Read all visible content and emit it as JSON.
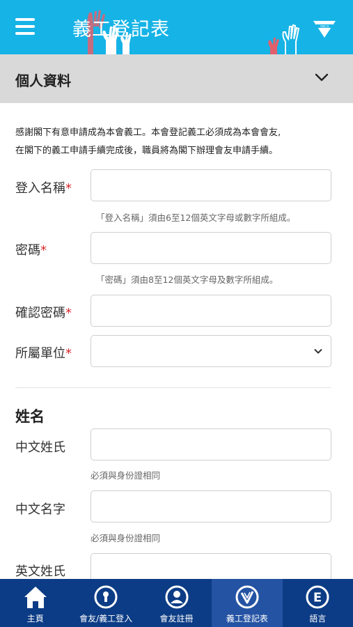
{
  "header": {
    "title": "義工登記表",
    "menu_icon": "hamburger-menu-icon",
    "logo_icon": "ymca-logo-icon",
    "bg_color": "#16b3e6"
  },
  "accordion": {
    "title": "個人資料",
    "icon": "chevron-down-icon"
  },
  "intro": {
    "line1": "感謝閣下有意申請成為本會義工。本會登記義工必須成為本會會友,",
    "line2": "在閣下的義工申請手續完成後，職員將為閣下辦理會友申請手續。"
  },
  "form": {
    "required_mark": "*",
    "login_name_label": "登入名稱",
    "login_name_hint": "「登入名稱」須由6至12個英文字母或數字所組成。",
    "password_label": "密碼",
    "password_hint": "「密碼」須由8至12個英文字母及數字所組成。",
    "confirm_password_label": "確認密碼",
    "unit_label": "所屬單位",
    "unit_value": ""
  },
  "name_section": {
    "title": "姓名",
    "chinese_surname_label": "中文姓氏",
    "chinese_surname_hint": "必須與身份證相同",
    "chinese_given_label": "中文名字",
    "chinese_given_hint": "必須與身份證相同",
    "english_surname_label": "英文姓氏"
  },
  "bottom_nav": {
    "items": [
      {
        "label": "主頁",
        "icon": "home-icon"
      },
      {
        "label": "會友/義工登入",
        "icon": "keyhole-icon"
      },
      {
        "label": "會友註冊",
        "icon": "user-icon"
      },
      {
        "label": "義工登記表",
        "icon": "check-badge-icon"
      },
      {
        "label": "語言",
        "icon": "language-e-icon"
      }
    ],
    "active_index": 3,
    "bg_color": "#0c3c85",
    "active_color": "#2453a3"
  },
  "colors": {
    "required": "#d9262b",
    "accordion_bg": "#d9d9d9"
  }
}
